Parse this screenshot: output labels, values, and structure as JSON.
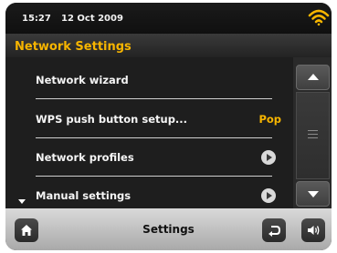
{
  "status": {
    "time": "15:27",
    "date": "12 Oct  2009",
    "wifi_icon": "wifi-icon"
  },
  "header": {
    "title": "Network Settings"
  },
  "menu": {
    "items": [
      {
        "label": "Network wizard",
        "value": "",
        "has_arrow": false
      },
      {
        "label": "WPS push button setup...",
        "value": "Pop",
        "has_arrow": false
      },
      {
        "label": "Network profiles",
        "value": "",
        "has_arrow": true
      },
      {
        "label": "Manual settings",
        "value": "",
        "has_arrow": true
      }
    ]
  },
  "footer": {
    "title": "Settings",
    "home_icon": "home-icon",
    "back_icon": "back-icon",
    "volume_icon": "volume-icon"
  },
  "colors": {
    "accent": "#f7b500",
    "background": "#1e1e1e",
    "bottom_bar": "#c8c8c8"
  }
}
